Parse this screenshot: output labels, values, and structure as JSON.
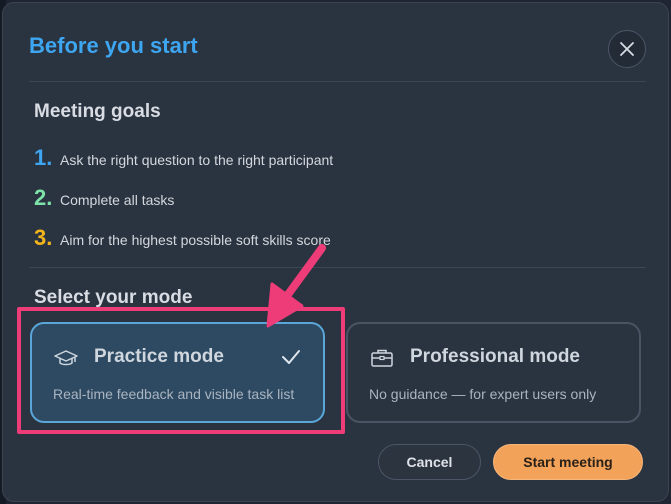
{
  "dialog": {
    "title": "Before you start",
    "close_icon": "close-icon"
  },
  "goals": {
    "heading": "Meeting goals",
    "items": [
      {
        "number": "1.",
        "text": "Ask the right question to the right participant",
        "color": "#3ea6f0"
      },
      {
        "number": "2.",
        "text": "Complete all tasks",
        "color": "#7ee2a8"
      },
      {
        "number": "3.",
        "text": "Aim for the highest possible soft skills score",
        "color": "#f4b41c"
      }
    ]
  },
  "modes": {
    "heading": "Select your mode",
    "items": [
      {
        "label": "Practice mode",
        "description": "Real-time feedback and visible task list",
        "icon": "graduation-cap-icon",
        "selected": true
      },
      {
        "label": "Professional mode",
        "description": "No guidance — for expert users only",
        "icon": "briefcase-icon",
        "selected": false
      }
    ]
  },
  "actions": {
    "cancel_label": "Cancel",
    "start_label": "Start meeting"
  },
  "colors": {
    "accent_blue": "#3ea6f0",
    "accent_orange": "#f3a259",
    "highlight_pink": "#ee3c78"
  }
}
